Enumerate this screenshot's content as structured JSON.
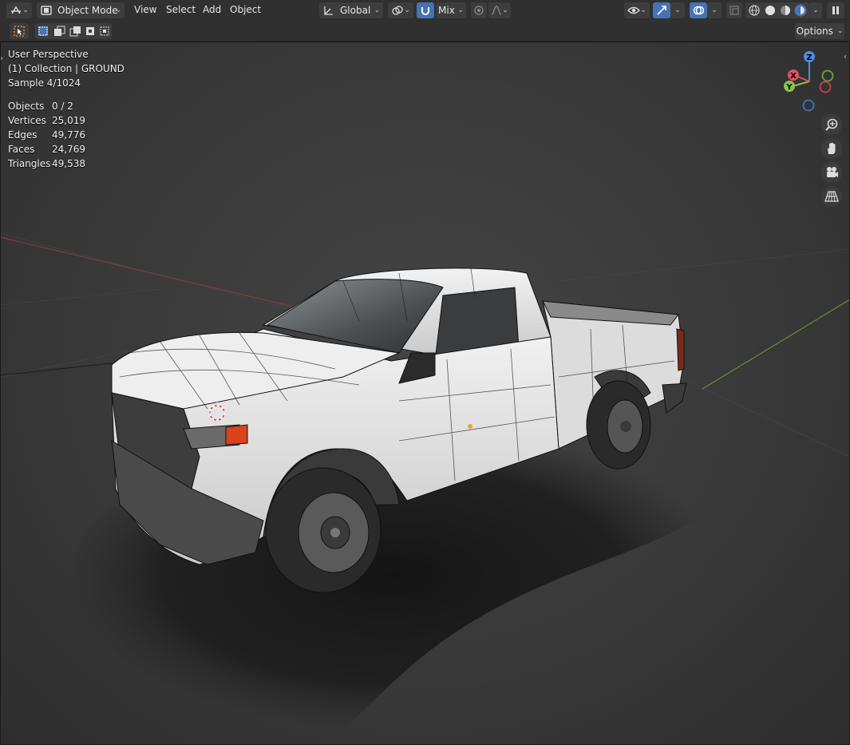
{
  "header": {
    "editor_type_icon": "viewport-editor-icon",
    "mode": {
      "label": "Object Mode",
      "icon": "object-mode-icon"
    },
    "menus": [
      "View",
      "Select",
      "Add",
      "Object"
    ],
    "transform_orientation": "Global",
    "snap_label": "Mix"
  },
  "subheader": {
    "options_label": "Options"
  },
  "overlay": {
    "view_name": "User Perspective",
    "collection": "(1) Collection | GROUND",
    "sample": "Sample 4/1024",
    "stats": [
      {
        "label": "Objects",
        "value": "0 / 2"
      },
      {
        "label": "Vertices",
        "value": "25,019"
      },
      {
        "label": "Edges",
        "value": "49,776"
      },
      {
        "label": "Faces",
        "value": "24,769"
      },
      {
        "label": "Triangles",
        "value": "49,538"
      }
    ]
  },
  "gizmo": {
    "z": "Z",
    "y": "Y",
    "x": "X"
  },
  "colors": {
    "header_bg": "#303030",
    "accent_blue": "#4772b3",
    "axis_x": "#e05263",
    "axis_y": "#8bc34a",
    "axis_z": "#4a90e2"
  }
}
